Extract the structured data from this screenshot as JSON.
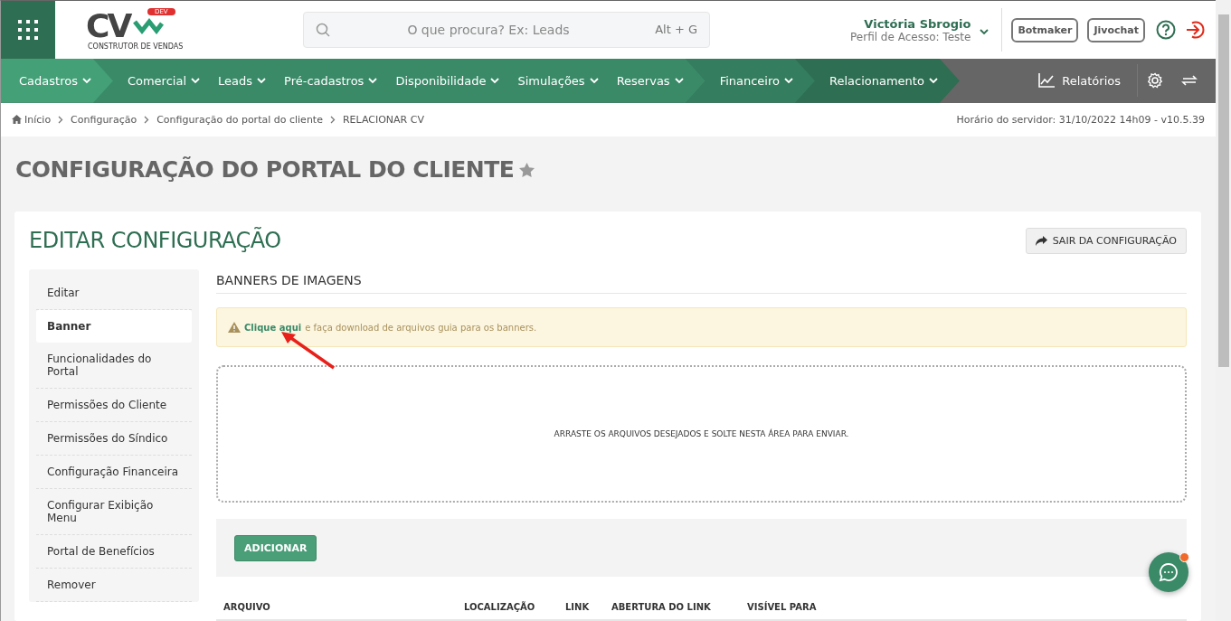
{
  "header": {
    "logo": {
      "text": "CV",
      "badge": "DEV",
      "tagline": "CONSTRUTOR DE VENDAS"
    },
    "search": {
      "placeholder": "O que procura? Ex: Leads",
      "shortcut": "Alt + G"
    },
    "user": {
      "name": "Victória Sbrogio",
      "profile": "Perfil de Acesso: Teste"
    },
    "buttons": [
      "Botmaker",
      "Jivochat"
    ]
  },
  "nav": {
    "segments": [
      {
        "color": "#43a077",
        "items": [
          "Cadastros"
        ]
      },
      {
        "color": "#3a8a68",
        "items": [
          "Comercial",
          "Leads",
          "Pré-cadastros",
          "Disponibilidade",
          "Simulações",
          "Reservas"
        ]
      },
      {
        "color": "#347d5e",
        "items": [
          "Financeiro"
        ]
      },
      {
        "color": "#2e6e52",
        "items": [
          "Relacionamento"
        ]
      }
    ],
    "reports": "Relatórios"
  },
  "breadcrumb": {
    "items": [
      "Início",
      "Configuração",
      "Configuração do portal do cliente",
      "RELACIONAR CV"
    ],
    "server_time": "Horário do servidor: 31/10/2022 14h09 - v10.5.39"
  },
  "page_title": "CONFIGURAÇÃO DO PORTAL DO CLIENTE",
  "card": {
    "title": "EDITAR CONFIGURAÇÃO",
    "exit_button": "SAIR DA CONFIGURAÇÃO",
    "menu": [
      {
        "label": "Editar",
        "selected": false
      },
      {
        "label": "Banner",
        "selected": true
      },
      {
        "label": "Funcionalidades do Portal",
        "selected": false
      },
      {
        "label": "Permissões do Cliente",
        "selected": false
      },
      {
        "label": "Permissões do Síndico",
        "selected": false
      },
      {
        "label": "Configuração Financeira",
        "selected": false
      },
      {
        "label": "Configurar Exibição Menu",
        "selected": false
      },
      {
        "label": "Portal de Benefícios",
        "selected": false
      },
      {
        "label": "Remover",
        "selected": false
      }
    ],
    "section_title": "BANNERS DE IMAGENS",
    "alert": {
      "link": "Clique aqui",
      "text": "e faça download de arquivos guia para os banners."
    },
    "dropzone": "ARRASTE OS ARQUIVOS DESEJADOS E SOLTE NESTA ÁREA PARA ENVIAR.",
    "add_button": "ADICIONAR",
    "table": {
      "columns": [
        "ARQUIVO",
        "LOCALIZAÇÃO",
        "LINK",
        "ABERTURA DO LINK",
        "VISÍVEL PARA"
      ]
    }
  }
}
